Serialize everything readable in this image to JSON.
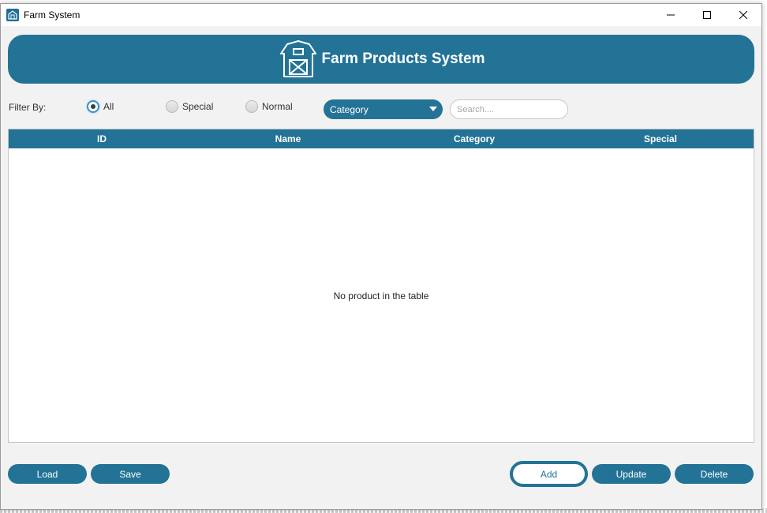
{
  "window": {
    "title": "Farm System",
    "controls": [
      "minimize",
      "maximize",
      "close"
    ]
  },
  "header": {
    "title": "Farm Products System",
    "icon": "barn-icon"
  },
  "filter": {
    "label": "Filter By:",
    "options": [
      {
        "label": "All",
        "selected": true
      },
      {
        "label": "Special",
        "selected": false
      },
      {
        "label": "Normal",
        "selected": false
      }
    ],
    "category": {
      "value": "Category"
    },
    "search": {
      "placeholder": "Search....",
      "value": ""
    }
  },
  "table": {
    "columns": [
      "ID",
      "Name",
      "Category",
      "Special"
    ],
    "rows": [],
    "empty_message": "No product in the table"
  },
  "actions": {
    "load": "Load",
    "save": "Save",
    "add": "Add",
    "update": "Update",
    "delete": "Delete"
  },
  "colors": {
    "primary": "#237396",
    "window_bg": "#f2f2f2",
    "radio_focus": "#3a95c8"
  }
}
